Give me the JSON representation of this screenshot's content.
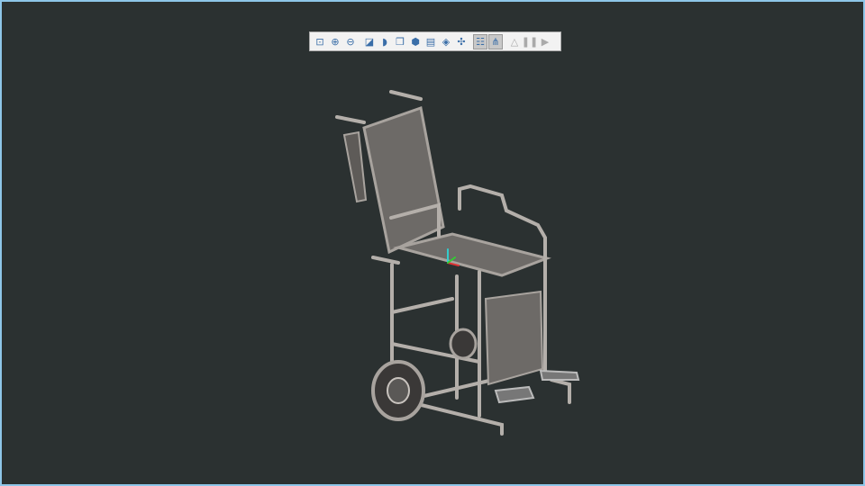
{
  "toolbar": {
    "buttons": [
      {
        "name": "fit-all",
        "icon": "fit-all-icon",
        "glyph": "⊡"
      },
      {
        "name": "zoom-in",
        "icon": "zoom-in-icon",
        "glyph": "⊕"
      },
      {
        "name": "zoom-out",
        "icon": "zoom-out-icon",
        "glyph": "⊖"
      },
      {
        "name": "shading",
        "icon": "shading-icon",
        "glyph": "◪"
      },
      {
        "name": "render-mode",
        "icon": "render-mode-icon",
        "glyph": "◗"
      },
      {
        "name": "view-cube",
        "icon": "view-cube-icon",
        "glyph": "❒"
      },
      {
        "name": "view-orientation",
        "icon": "view-orientation-icon",
        "glyph": "⬢"
      },
      {
        "name": "capture",
        "icon": "camera-icon",
        "glyph": "▤"
      },
      {
        "name": "section",
        "icon": "section-icon",
        "glyph": "◈"
      },
      {
        "name": "explode",
        "icon": "explode-icon",
        "glyph": "✣"
      },
      {
        "name": "structure-tree",
        "icon": "tree-icon",
        "glyph": "☷",
        "active": true
      },
      {
        "name": "connections",
        "icon": "connection-icon",
        "glyph": "⋔",
        "active": true
      },
      {
        "name": "measure",
        "icon": "triangle-icon",
        "glyph": "△",
        "disabled": true
      },
      {
        "name": "pause",
        "icon": "pause-icon",
        "glyph": "❚❚",
        "disabled": true
      },
      {
        "name": "play",
        "icon": "play-icon",
        "glyph": "▶",
        "disabled": true
      }
    ]
  },
  "colors": {
    "background": "#2b3131",
    "frame": "#8ec6e8",
    "model": "#a8a39e"
  }
}
